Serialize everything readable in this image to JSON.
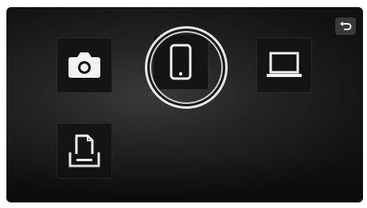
{
  "screen": {
    "icons": {
      "camera": "camera-icon",
      "smartphone": "smartphone-icon",
      "computer": "laptop-icon",
      "printer": "printer-icon",
      "back": "back-arrow-icon"
    },
    "selected": "smartphone",
    "colors": {
      "background": "#1e1e1e",
      "tile": "#141414",
      "icon": "#f2f2f2",
      "selection_ring": "#e8e8e8"
    }
  }
}
